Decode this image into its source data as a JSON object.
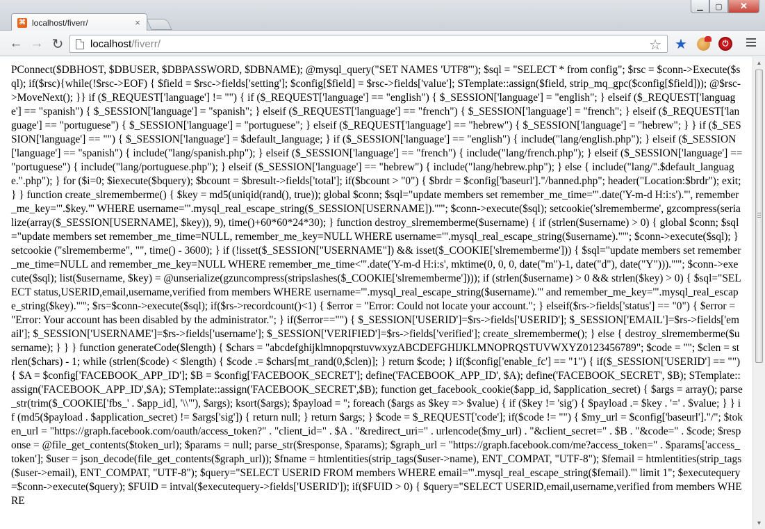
{
  "window": {
    "tab_title": "localhost/fiverr/",
    "favicon_glyph": "⌘",
    "tab_close": "×",
    "controls": {
      "minimize": "▁",
      "maximize": "▢",
      "close": "✕"
    }
  },
  "toolbar": {
    "back_icon": "←",
    "forward_icon": "→",
    "reload_icon": "↻",
    "url_host": "localhost",
    "url_path": "/fiverr/",
    "bookmark_star": "☆",
    "ext_star": "★",
    "adblock_glyph": "⏻"
  },
  "colors": {
    "close_button": "#c7463a",
    "favicon": "#e8641b",
    "ext_blue": "#1f5fc7",
    "adblock_red": "#c6171c"
  },
  "page": {
    "text": "PConnect($DBHOST, $DBUSER, $DBPASSWORD, $DBNAME); @mysql_query(\"SET NAMES 'UTF8'\"); $sql = \"SELECT * from config\"; $rsc = $conn->Execute($sql); if($rsc){while(!$rsc->EOF) { $field = $rsc->fields['setting']; $config[$field] = $rsc->fields['value']; STemplate::assign($field, strip_mq_gpc($config[$field])); @$rsc->MoveNext(); }} if ($_REQUEST['language'] != \"\") { if ($_REQUEST['language'] == \"english\") { $_SESSION['language'] = \"english\"; } elseif ($_REQUEST['language'] == \"spanish\") { $_SESSION['language'] = \"spanish\"; } elseif ($_REQUEST['language'] == \"french\") { $_SESSION['language'] = \"french\"; } elseif ($_REQUEST['language'] == \"portuguese\") { $_SESSION['language'] = \"portuguese\"; } elseif ($_REQUEST['language'] == \"hebrew\") { $_SESSION['language'] = \"hebrew\"; } } if ($_SESSION['language'] == \"\") { $_SESSION['language'] = $default_language; } if ($_SESSION['language'] == \"english\") { include(\"lang/english.php\"); } elseif ($_SESSION['language'] == \"spanish\") { include(\"lang/spanish.php\"); } elseif ($_SESSION['language'] == \"french\") { include(\"lang/french.php\"); } elseif ($_SESSION['language'] == \"portuguese\") { include(\"lang/portuguese.php\"); } elseif ($_SESSION['language'] == \"hebrew\") { include(\"lang/hebrew.php\"); } else { include(\"lang/\".$default_language.\".php\"); } for ($i=0; $iexecute($bquery); $bcount = $bresult->fields['total']; if($bcount > \"0\") { $brdr = $config['baseurl'].\"/banned.php\"; header(\"Location:$brdr\"); exit; } } function create_slrememberme() { $key = md5(uniqid(rand(), true)); global $conn; $sql=\"update members set remember_me_time='\".date('Y-m-d H:i:s').\"', remember_me_key='\".$key.\"' WHERE username='\".mysql_real_escape_string($_SESSION[USERNAME]).\"'\"; $conn->execute($sql); setcookie('slrememberme', gzcompress(serialize(array($_SESSION[USERNAME], $key)), 9), time()+60*60*24*30); } function destroy_slrememberme($username) { if (strlen($username) > 0) { global $conn; $sql=\"update members set remember_me_time=NULL, remember_me_key=NULL WHERE username='\".mysql_real_escape_string($username).\"'\"; $conn->execute($sql); } setcookie (\"slrememberme\", \"\", time() - 3600); } if (!isset($_SESSION[\"USERNAME\"]) && isset($_COOKIE['slrememberme'])) { $sql=\"update members set remember_me_time=NULL and remember_me_key=NULL WHERE remember_me_time<'\".date('Y-m-d H:i:s', mktime(0, 0, 0, date(\"m\")-1, date(\"d\"), date(\"Y\"))).\"'\"; $conn->execute($sql); list($username, $key) = @unserialize(gzuncompress(stripslashes($_COOKIE['slrememberme']))); if (strlen($username) > 0 && strlen($key) > 0) { $sql=\"SELECT status,USERID,email,username,verified from members WHERE username='\".mysql_real_escape_string($username).\"' and remember_me_key='\".mysql_real_escape_string($key).\"'\"; $rs=$conn->execute($sql); if($rs->recordcount()<1) { $error = \"Error: Could not locate your account.\"; } elseif($rs->fields['status'] == \"0\") { $error = \"Error: Your account has been disabled by the administrator.\"; } if($error==\"\") { $_SESSION['USERID']=$rs->fields['USERID']; $_SESSION['EMAIL']=$rs->fields['email']; $_SESSION['USERNAME']=$rs->fields['username']; $_SESSION['VERIFIED']=$rs->fields['verified']; create_slrememberme(); } else { destroy_slrememberme($username); } } } function generateCode($length) { $chars = \"abcdefghijklmnopqrstuvwxyzABCDEFGHIJKLMNOPRQSTUVWXYZ0123456789\"; $code = \"\"; $clen = strlen($chars) - 1; while (strlen($code) < $length) { $code .= $chars[mt_rand(0,$clen)]; } return $code; } if($config['enable_fc'] == \"1\") { if($_SESSION['USERID'] == \"\") { $A = $config['FACEBOOK_APP_ID']; $B = $config['FACEBOOK_SECRET']; define('FACEBOOK_APP_ID', $A); define('FACEBOOK_SECRET', $B); STemplate::assign('FACEBOOK_APP_ID',$A); STemplate::assign('FACEBOOK_SECRET',$B); function get_facebook_cookie($app_id, $application_secret) { $args = array(); parse_str(trim($_COOKIE['fbs_' . $app_id], '\\\\\"'), $args); ksort($args); $payload = ''; foreach ($args as $key => $value) { if ($key != 'sig') { $payload .= $key . '=' . $value; } } if (md5($payload . $application_secret) != $args['sig']) { return null; } return $args; } $code = $_REQUEST['code']; if($code != \"\") { $my_url = $config['baseurl'].\"/\"; $token_url = \"https://graph.facebook.com/oauth/access_token?\" . \"client_id=\" . $A . \"&redirect_uri=\" . urlencode($my_url) . \"&client_secret=\" . $B . \"&code=\" . $code; $response = @file_get_contents($token_url); $params = null; parse_str($response, $params); $graph_url = \"https://graph.facebook.com/me?access_token=\" . $params['access_token']; $user = json_decode(file_get_contents($graph_url)); $fname = htmlentities(strip_tags($user->name), ENT_COMPAT, \"UTF-8\"); $femail = htmlentities(strip_tags($user->email), ENT_COMPAT, \"UTF-8\"); $query=\"SELECT USERID FROM members WHERE email='\".mysql_real_escape_string($femail).\"' limit 1\"; $executequery=$conn->execute($query); $FUID = intval($executequery->fields['USERID']); if($FUID > 0) { $query=\"SELECT USERID,email,username,verified from members WHERE"
  }
}
